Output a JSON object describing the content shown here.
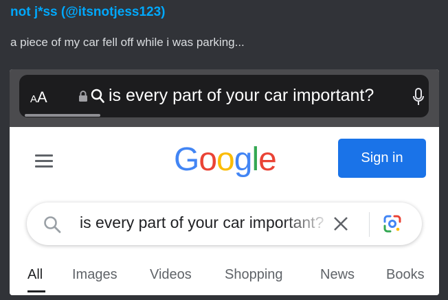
{
  "post": {
    "author": "not j*ss (@itsnotjess123)",
    "caption": "a piece of my car fell off while i was parking..."
  },
  "browser": {
    "text_size_small": "A",
    "text_size_large": "A",
    "url_text": "is every part of your car important?",
    "icons": [
      "lock-icon",
      "search-icon",
      "microphone-icon"
    ]
  },
  "google": {
    "menu_icon": "hamburger-menu-icon",
    "logo_letters": [
      {
        "char": "G",
        "color": "#4285F4"
      },
      {
        "char": "o",
        "color": "#EA4335"
      },
      {
        "char": "o",
        "color": "#FBBC05"
      },
      {
        "char": "g",
        "color": "#4285F4"
      },
      {
        "char": "l",
        "color": "#34A853"
      },
      {
        "char": "e",
        "color": "#EA4335"
      }
    ],
    "sign_in_label": "Sign in",
    "search": {
      "query": "is every part of your car important?",
      "icons": [
        "search-icon",
        "clear-icon",
        "google-lens-icon"
      ]
    },
    "tabs": [
      {
        "label": "All",
        "active": true
      },
      {
        "label": "Images",
        "active": false
      },
      {
        "label": "Videos",
        "active": false
      },
      {
        "label": "Shopping",
        "active": false
      },
      {
        "label": "News",
        "active": false
      },
      {
        "label": "Books",
        "active": false
      }
    ]
  },
  "colors": {
    "background": "#313338",
    "author": "#00a8fc",
    "accent": "#1a73e8"
  }
}
